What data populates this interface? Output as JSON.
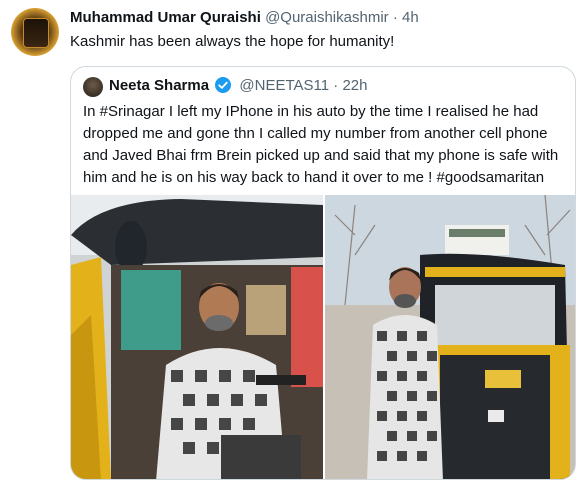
{
  "tweet": {
    "author_name": "Muhammad Umar Quraishi",
    "handle": "@Quraishikashmir",
    "separator": "·",
    "time": "4h",
    "text": "Kashmir has been always the hope for humanity!",
    "avatar_icon": "profile-avatar"
  },
  "quoted_tweet": {
    "author_name": "Neeta Sharma",
    "verified_icon": "verified-badge-icon",
    "handle": "@NEETAS11",
    "separator": "·",
    "time": "22h",
    "text": "In #Srinagar I left my IPhone in his auto by the time I realised he had dropped me and gone thn I called my number from another cell phone and Javed Bhai frm Brein picked up and said that my phone is safe with him and he is on his way back to hand it over to me ! #goodsamaritan",
    "media": [
      {
        "name": "photo-driver-in-auto"
      },
      {
        "name": "photo-driver-standing-by-auto"
      }
    ]
  },
  "colors": {
    "text": "#0f1419",
    "secondary": "#536471",
    "border": "#cfd9de",
    "verified": "#1d9bf0"
  }
}
